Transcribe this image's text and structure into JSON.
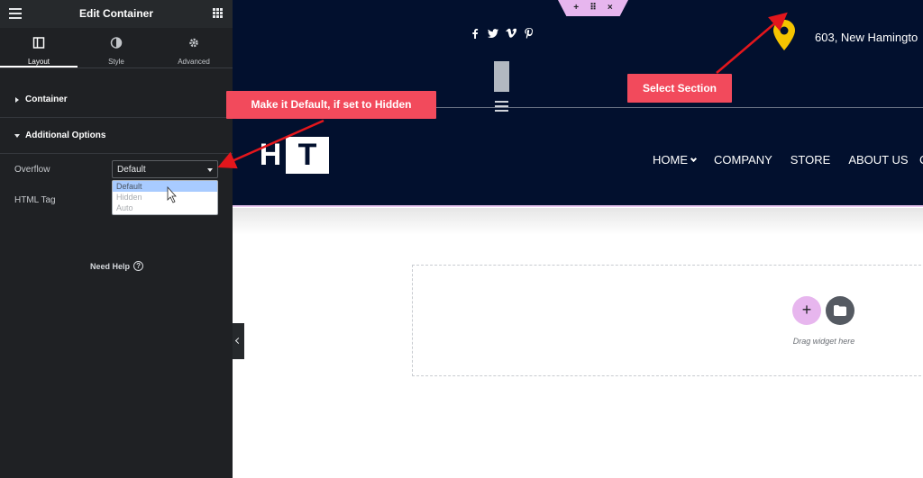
{
  "sidebar": {
    "title": "Edit Container",
    "tabs": [
      {
        "label": "Layout",
        "active": true
      },
      {
        "label": "Style",
        "active": false
      },
      {
        "label": "Advanced",
        "active": false
      }
    ],
    "sections": {
      "container": "Container",
      "additional_options": "Additional Options"
    },
    "controls": {
      "overflow_label": "Overflow",
      "overflow_value": "Default",
      "overflow_options": [
        "Default",
        "Hidden",
        "Auto"
      ],
      "html_tag_label": "HTML Tag"
    },
    "need_help": "Need Help",
    "need_help_icon": "?"
  },
  "site": {
    "address": "603, New Hamingto",
    "logo_left": "H",
    "logo_right": "T",
    "nav": [
      "HOME",
      "COMPANY",
      "STORE",
      "ABOUT US"
    ],
    "nav_clipped": "C",
    "social_icons": [
      "facebook-icon",
      "twitter-icon",
      "vimeo-icon",
      "pinterest-icon"
    ],
    "section_handle": [
      "+",
      "⠿",
      "×"
    ]
  },
  "callouts": {
    "default_hint": "Make it Default, if set to Hidden",
    "select_section": "Select Section"
  },
  "canvas": {
    "drag_text": "Drag widget here",
    "add_symbol": "+"
  },
  "colors": {
    "panel_bg": "#1f2124",
    "header_bg": "#02102e",
    "callout": "#f24a5c",
    "accent_pink": "#e7b6ee",
    "pin_yellow": "#f5c400"
  }
}
